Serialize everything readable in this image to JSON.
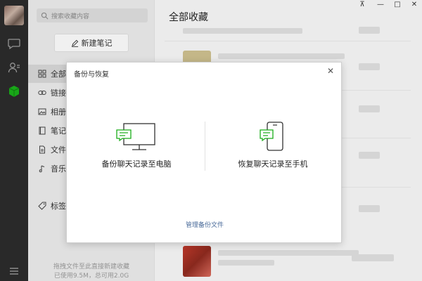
{
  "sidebar": {
    "search_placeholder": "搜索收藏内容",
    "new_note_label": "新建笔记",
    "items": [
      {
        "label": "全部收藏",
        "icon": "grid-icon"
      },
      {
        "label": "链接",
        "icon": "link-icon"
      },
      {
        "label": "相册",
        "icon": "image-icon"
      },
      {
        "label": "笔记",
        "icon": "note-icon"
      },
      {
        "label": "文件",
        "icon": "file-icon"
      },
      {
        "label": "音乐",
        "icon": "music-icon"
      },
      {
        "label": "标签",
        "icon": "tag-icon"
      }
    ],
    "storage_line1": "拖拽文件至此直接新建收藏",
    "storage_line2": "已使用9.5M，总可用2.0G"
  },
  "main": {
    "title": "全部收藏"
  },
  "dialog": {
    "title": "备份与恢复",
    "backup_label": "备份聊天记录至电脑",
    "restore_label": "恢复聊天记录至手机",
    "manage_link": "管理备份文件"
  },
  "colors": {
    "accent_green": "#1aad19",
    "link_blue": "#4a6b9a",
    "rail_bg": "#2b2b2b"
  }
}
